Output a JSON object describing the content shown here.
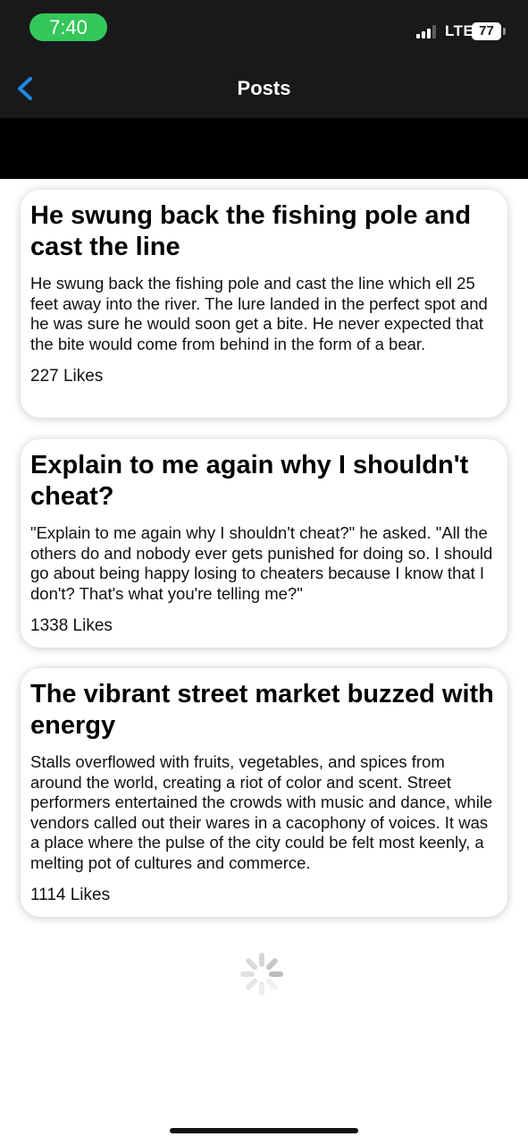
{
  "status_bar": {
    "time": "7:40",
    "network": "LTE",
    "battery": "77",
    "colors": {
      "time_pill": "#34c759",
      "background": "#19191b"
    }
  },
  "nav": {
    "title": "Posts",
    "back_icon": "chevron-left-icon",
    "accent": "#1e88e5"
  },
  "posts": [
    {
      "title": "He swung back the fishing pole and cast the line",
      "body": "He swung back the fishing pole and cast the line which ell 25 feet away into the river. The lure landed in the perfect spot and he was sure he would soon get a bite. He never expected that the bite would come from behind in the form of a bear.",
      "likes": "227 Likes"
    },
    {
      "title": "Explain to me again why I shouldn't cheat?",
      "body": "\"Explain to me again why I shouldn't cheat?\" he asked. \"All the others do and nobody ever gets punished for doing so. I should go about being happy losing to cheaters because I know that I don't? That's what you're telling me?\"",
      "likes": "1338 Likes"
    },
    {
      "title": "The vibrant street market buzzed with energy",
      "body": "Stalls overflowed with fruits, vegetables, and spices from around the world, creating a riot of color and scent. Street performers entertained the crowds with music and dance, while vendors called out their wares in a cacophony of voices. It was a place where the pulse of the city could be felt most keenly, a melting pot of cultures and commerce.",
      "likes": "1114 Likes"
    }
  ],
  "loading_icon": "spinner-icon"
}
